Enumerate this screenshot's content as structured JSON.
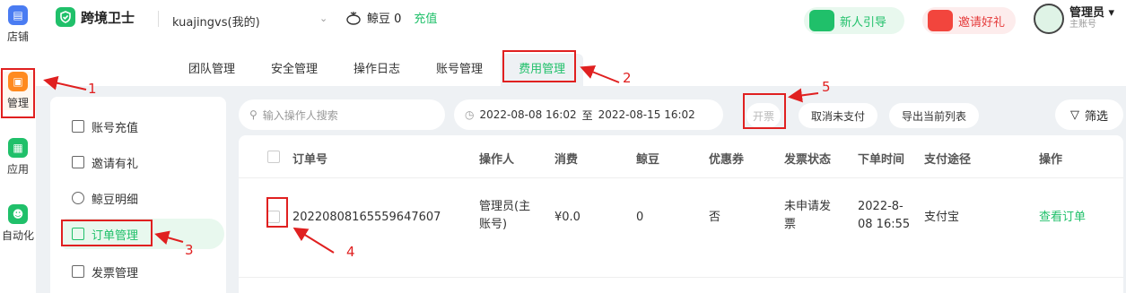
{
  "rail": {
    "items": [
      {
        "label": "店铺",
        "color": "#4a7cf2"
      },
      {
        "label": "管理",
        "color": "#ff8a1f"
      },
      {
        "label": "应用",
        "color": "#20c06a"
      },
      {
        "label": "自动化",
        "color": "#20c06a"
      }
    ]
  },
  "header": {
    "brand": "跨境卫士",
    "store": "kuajingvs(我的)",
    "bean_label": "鲸豆 0",
    "recharge": "充值",
    "promo_guide": "新人引导",
    "promo_invite": "邀请好礼",
    "user_name": "管理员",
    "user_sub": "主账号",
    "user_caret": "▾"
  },
  "tabs": [
    "团队管理",
    "安全管理",
    "操作日志",
    "账号管理",
    "费用管理"
  ],
  "subnav": [
    "账号充值",
    "邀请有礼",
    "鲸豆明细",
    "订单管理",
    "发票管理"
  ],
  "toolbar": {
    "search_placeholder": "输入操作人搜索",
    "date_start": "2022-08-08 16:02",
    "date_sep": "至",
    "date_end": "2022-08-15 16:02",
    "invoice": "开票",
    "cancel_unpaid": "取消未支付",
    "export": "导出当前列表",
    "filter": "筛选"
  },
  "table": {
    "headers": [
      "订单号",
      "操作人",
      "消费",
      "鲸豆",
      "优惠券",
      "发票状态",
      "下单时间",
      "支付途径",
      "操作"
    ],
    "row": {
      "order_no": "20220808165559647607",
      "operator": "管理员(主账号)",
      "cost": "¥0.0",
      "bean": "0",
      "coupon": "否",
      "invoice_status": "未申请发票",
      "time": "2022-8-08 16:55",
      "pay": "支付宝",
      "action": "查看订单"
    }
  },
  "annotations": [
    "1",
    "2",
    "3",
    "4",
    "5"
  ],
  "colors": {
    "accent": "#20c06a",
    "annotation": "#e02020"
  }
}
